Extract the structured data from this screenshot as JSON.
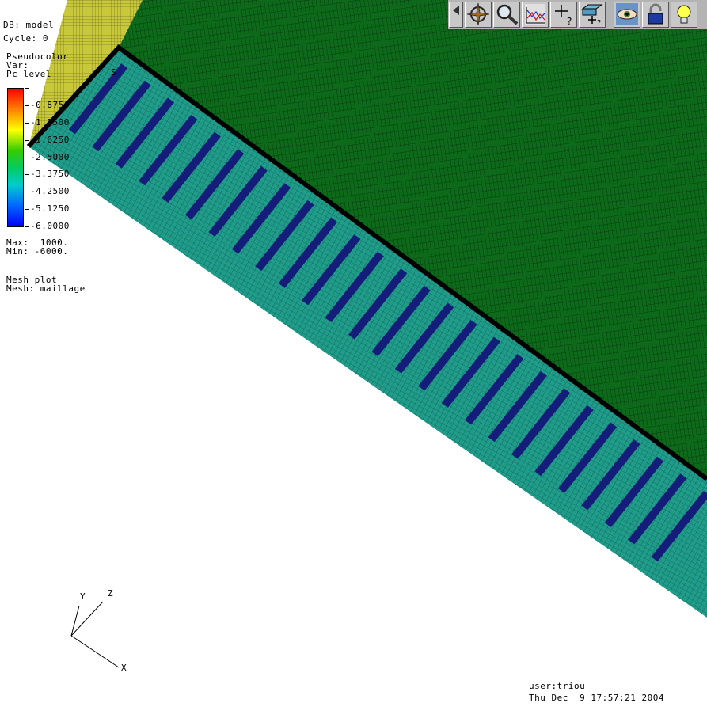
{
  "header": {
    "db": "DB: model",
    "cycle": "Cycle: 0"
  },
  "legend": {
    "plot_type": "Pseudocolor",
    "var": "Var: ",
    "var_tail": "S",
    "pc_level": "Pc level",
    "ticks": [
      "-0.8750",
      "-1.7500",
      "-1.6250",
      "-2.5000",
      "-3.3750",
      "-4.2500",
      "-5.1250",
      "-6.0000"
    ],
    "max": "Max:  1000.",
    "min": "Min: -6000."
  },
  "mesh": {
    "plot": "Mesh plot",
    "name": "Mesh: maillage"
  },
  "axes": {
    "x": "X",
    "y": "Y",
    "z": "Z"
  },
  "footer": {
    "user": "user:triou",
    "date": "Thu Dec  9 17:57:21 2004"
  },
  "toolbar": {
    "buttons": [
      {
        "name": "popout-arrow-icon"
      },
      {
        "name": "navigate-compass-icon"
      },
      {
        "name": "zoom-magnifier-icon"
      },
      {
        "name": "lineout-curve-icon"
      },
      {
        "name": "pick-point-icon"
      },
      {
        "name": "pick-zone-icon"
      },
      {
        "name": "view-eye-icon"
      },
      {
        "name": "lock-icon"
      },
      {
        "name": "lightbulb-icon"
      }
    ]
  },
  "colors": {
    "teal_face": "#1f9c8a",
    "green_face": "#0c6a1a",
    "yellow_face": "#c8c83a",
    "stripe": "#141e7a"
  }
}
